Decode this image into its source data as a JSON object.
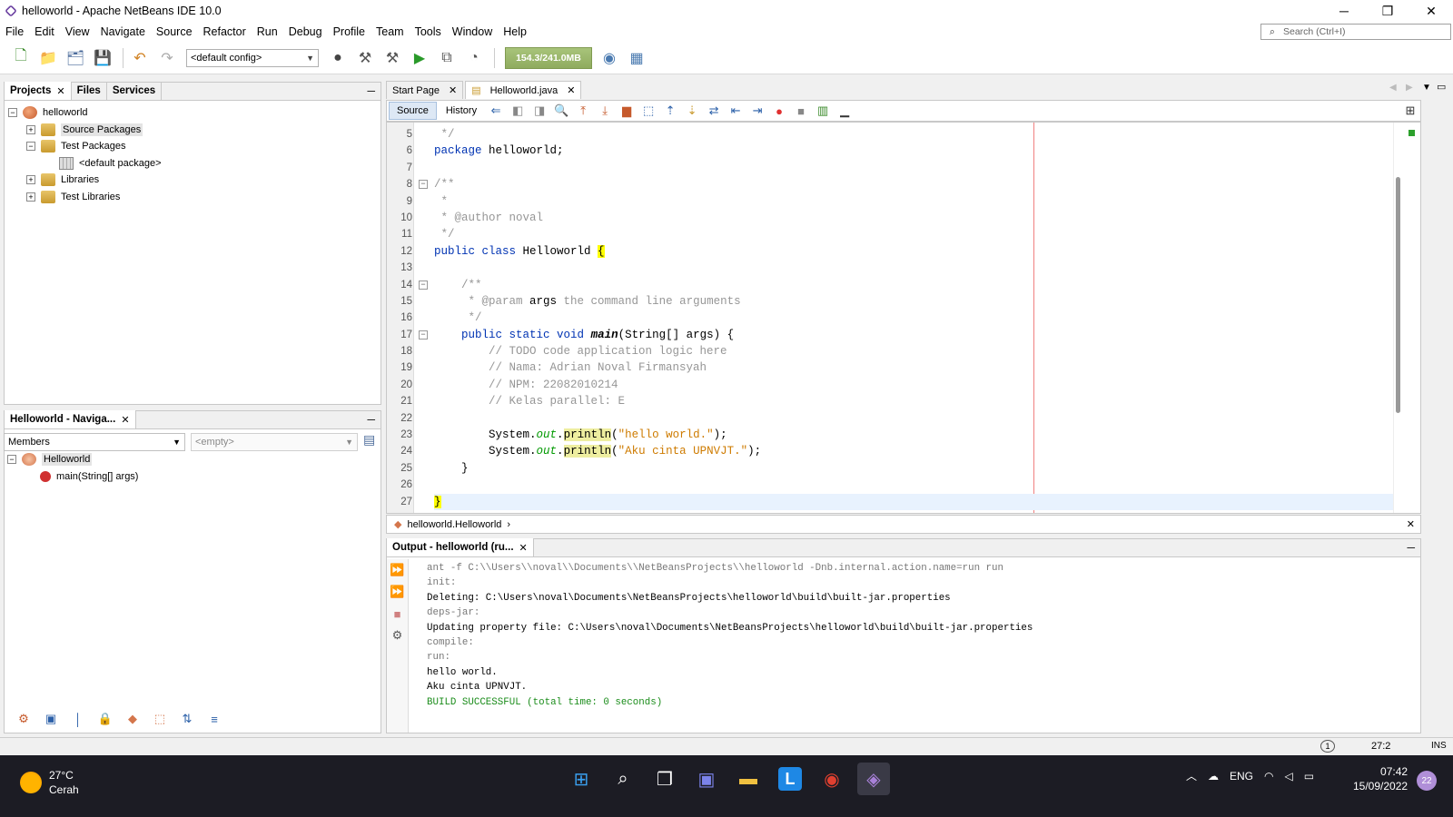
{
  "window": {
    "title": "helloworld - Apache NetBeans IDE 10.0",
    "minimize": "─",
    "restore": "❐",
    "close": "✕"
  },
  "menu": [
    "File",
    "Edit",
    "View",
    "Navigate",
    "Source",
    "Refactor",
    "Run",
    "Debug",
    "Profile",
    "Team",
    "Tools",
    "Window",
    "Help"
  ],
  "search": {
    "placeholder": "Search (Ctrl+I)"
  },
  "toolbar": {
    "config": "<default config>",
    "memory": "154.3/241.0MB"
  },
  "projects_panel": {
    "tabs": [
      "Projects",
      "Files",
      "Services"
    ],
    "tree": [
      {
        "label": "helloworld",
        "level": 0
      },
      {
        "label": "Source Packages",
        "level": 1
      },
      {
        "label": "Test Packages",
        "level": 1
      },
      {
        "label": "<default package>",
        "level": 2
      },
      {
        "label": "Libraries",
        "level": 1
      },
      {
        "label": "Test Libraries",
        "level": 1
      }
    ]
  },
  "navigator": {
    "title": "Helloworld - Naviga...",
    "members": "Members",
    "filter": "<empty>",
    "tree": [
      {
        "label": "Helloworld"
      },
      {
        "label": "main(String[] args)"
      }
    ]
  },
  "editor": {
    "tabs": [
      "Start Page",
      "Helloworld.java"
    ],
    "modes": [
      "Source",
      "History"
    ],
    "breadcrumb": "helloworld.Helloworld",
    "lines": [
      "5",
      "6",
      "7",
      "8",
      "9",
      "10",
      "11",
      "12",
      "13",
      "14",
      "15",
      "16",
      "17",
      "18",
      "19",
      "20",
      "21",
      "22",
      "23",
      "24",
      "25",
      "26",
      "27"
    ]
  },
  "output": {
    "title": "Output - helloworld (ru...",
    "lines": [
      "ant -f C:\\\\Users\\\\noval\\\\Documents\\\\NetBeansProjects\\\\helloworld -Dnb.internal.action.name=run run",
      "init:",
      "Deleting: C:\\Users\\noval\\Documents\\NetBeansProjects\\helloworld\\build\\built-jar.properties",
      "deps-jar:",
      "Updating property file: C:\\Users\\noval\\Documents\\NetBeansProjects\\helloworld\\build\\built-jar.properties",
      "compile:",
      "run:",
      "hello world.",
      "Aku cinta UPNVJT.",
      "BUILD SUCCESSFUL (total time: 0 seconds)"
    ]
  },
  "status": {
    "notifications": "1",
    "position": "27:2",
    "mode": "INS"
  },
  "taskbar": {
    "temp": "27°C",
    "condition": "Cerah",
    "lang": "ENG",
    "time": "07:42",
    "date": "15/09/2022",
    "badge": "22"
  }
}
